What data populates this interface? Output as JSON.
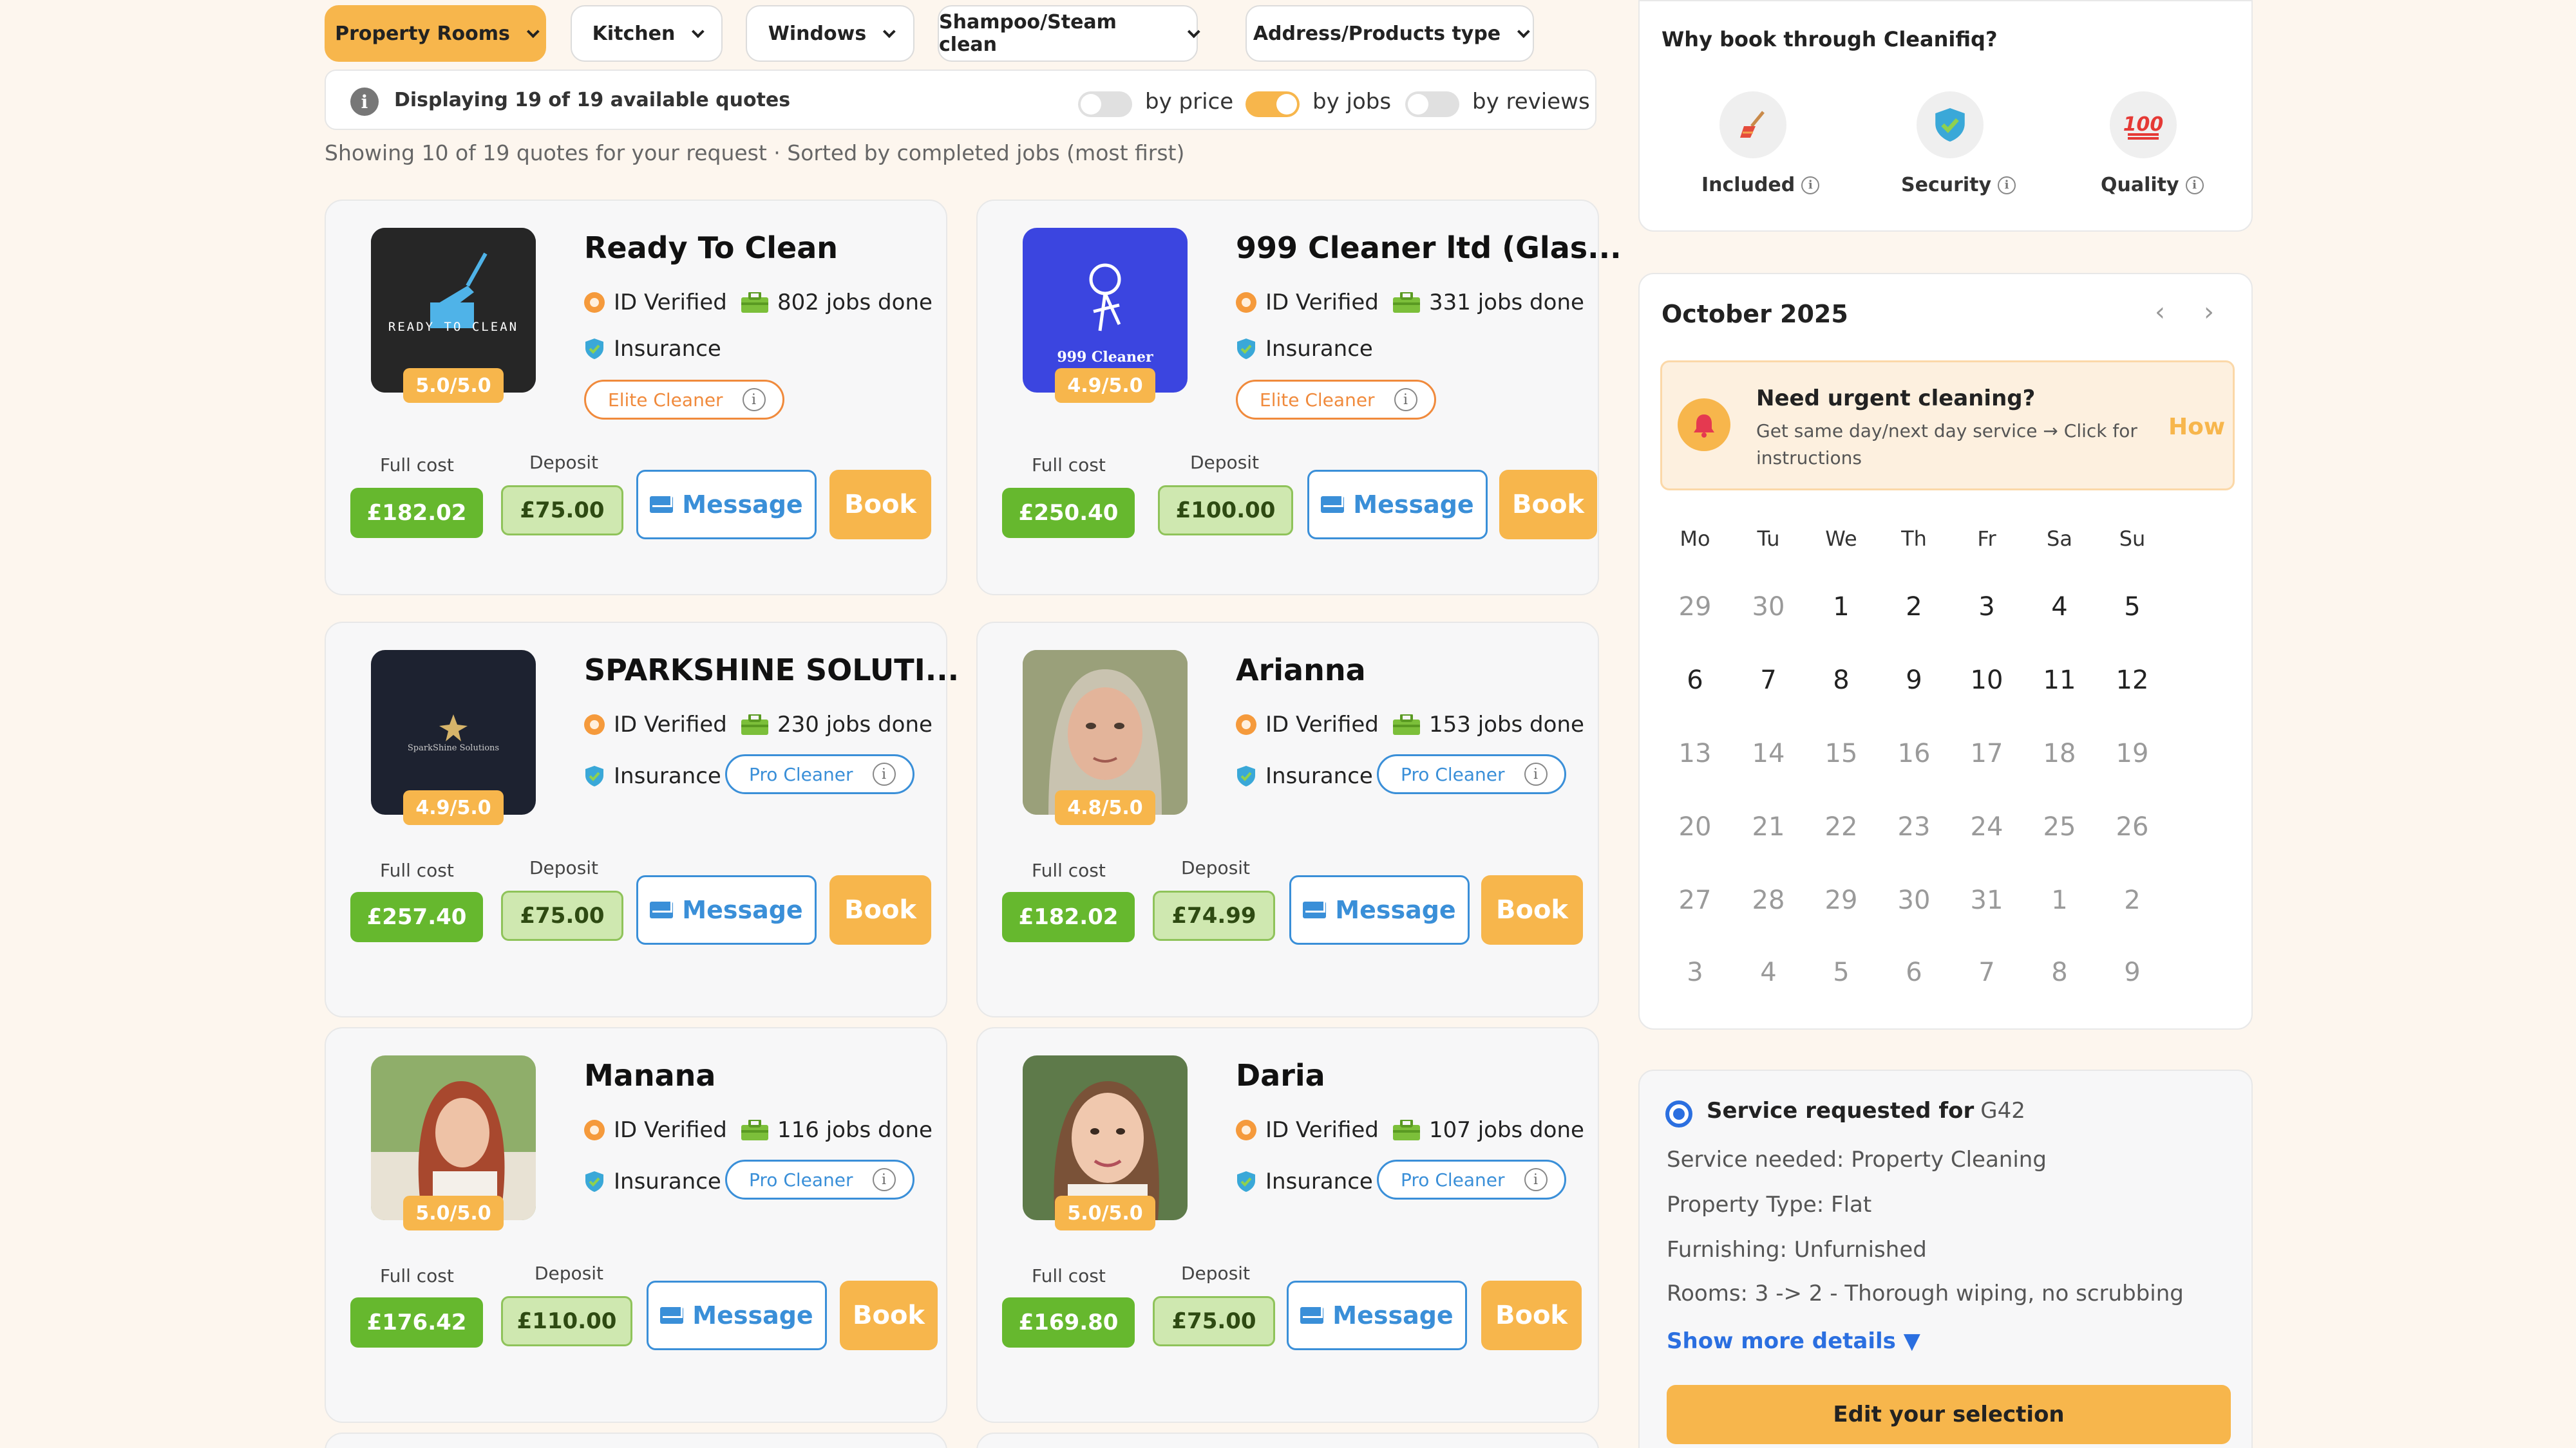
{
  "filters": [
    {
      "label": "Property Rooms",
      "active": true
    },
    {
      "label": "Kitchen",
      "active": false
    },
    {
      "label": "Windows",
      "active": false
    },
    {
      "label": "Shampoo/Steam clean",
      "active": false
    },
    {
      "label": "Address/Products type",
      "active": false
    }
  ],
  "info": {
    "displaying": "Displaying 19 of 19 available quotes",
    "sort_price": "by price",
    "sort_jobs": "by jobs",
    "sort_reviews": "by reviews",
    "subline": "Showing 10 of 19 quotes for your request · Sorted by completed jobs (most first)"
  },
  "labels": {
    "id_verified": "ID Verified",
    "insurance": "Insurance",
    "full_cost": "Full cost",
    "deposit": "Deposit",
    "message": "Message",
    "book": "Book"
  },
  "cleaners": [
    {
      "name": "Ready To Clean",
      "rating": "5.0/5.0",
      "jobs": "802 jobs done",
      "tier": "Elite Cleaner",
      "full_cost": "£182.02",
      "deposit": "£75.00",
      "avatar_text": "READY TO CLEAN"
    },
    {
      "name": "999 Cleaner ltd (Glas...",
      "rating": "4.9/5.0",
      "jobs": "331 jobs done",
      "tier": "Elite Cleaner",
      "full_cost": "£250.40",
      "deposit": "£100.00",
      "avatar_text": "999 Cleaner"
    },
    {
      "name": "SPARKSHINE SOLUTI...",
      "rating": "4.9/5.0",
      "jobs": "230 jobs done",
      "tier": "Pro Cleaner",
      "full_cost": "£257.40",
      "deposit": "£75.00",
      "avatar_text": "SparkShine Solutions"
    },
    {
      "name": "Arianna",
      "rating": "4.8/5.0",
      "jobs": "153 jobs done",
      "tier": "Pro Cleaner",
      "full_cost": "£182.02",
      "deposit": "£74.99",
      "avatar_text": ""
    },
    {
      "name": "Manana",
      "rating": "5.0/5.0",
      "jobs": "116 jobs done",
      "tier": "Pro Cleaner",
      "full_cost": "£176.42",
      "deposit": "£110.00",
      "avatar_text": ""
    },
    {
      "name": "Daria",
      "rating": "5.0/5.0",
      "jobs": "107 jobs done",
      "tier": "Pro Cleaner",
      "full_cost": "£169.80",
      "deposit": "£75.00",
      "avatar_text": ""
    }
  ],
  "why": {
    "title": "Why book through Cleanifiq?",
    "items": [
      {
        "label": "Included",
        "icon": "broom-icon"
      },
      {
        "label": "Security",
        "icon": "shield-check-icon"
      },
      {
        "label": "Quality",
        "icon": "hundred-points-icon"
      }
    ]
  },
  "calendar": {
    "month": "October 2025",
    "prev": "‹",
    "next": "›",
    "urgent_title": "Need urgent cleaning?",
    "urgent_desc": "Get same day/next day service → Click for instructions",
    "urgent_link": "How",
    "weekdays": [
      "Mo",
      "Tu",
      "We",
      "Th",
      "Fr",
      "Sa",
      "Su"
    ],
    "weeks": [
      [
        "29",
        "30",
        "1",
        "2",
        "3",
        "4",
        "5"
      ],
      [
        "6",
        "7",
        "8",
        "9",
        "10",
        "11",
        "12"
      ],
      [
        "13",
        "14",
        "15",
        "16",
        "17",
        "18",
        "19"
      ],
      [
        "20",
        "21",
        "22",
        "23",
        "24",
        "25",
        "26"
      ],
      [
        "27",
        "28",
        "29",
        "30",
        "31",
        "1",
        "2"
      ],
      [
        "3",
        "4",
        "5",
        "6",
        "7",
        "8",
        "9"
      ]
    ]
  },
  "service": {
    "heading": "Service requested for",
    "postcode": "G42",
    "lines": [
      "Service needed: Property Cleaning",
      "Property Type: Flat",
      "Furnishing: Unfurnished",
      "Rooms: 3 -> 2 - Thorough wiping, no scrubbing"
    ],
    "more": "Show more details ▼",
    "edit": "Edit your selection"
  },
  "colors": {
    "accent": "#f7b64c",
    "green": "#66b82e",
    "blue": "#3a8fd8",
    "elite": "#f08a3c"
  }
}
